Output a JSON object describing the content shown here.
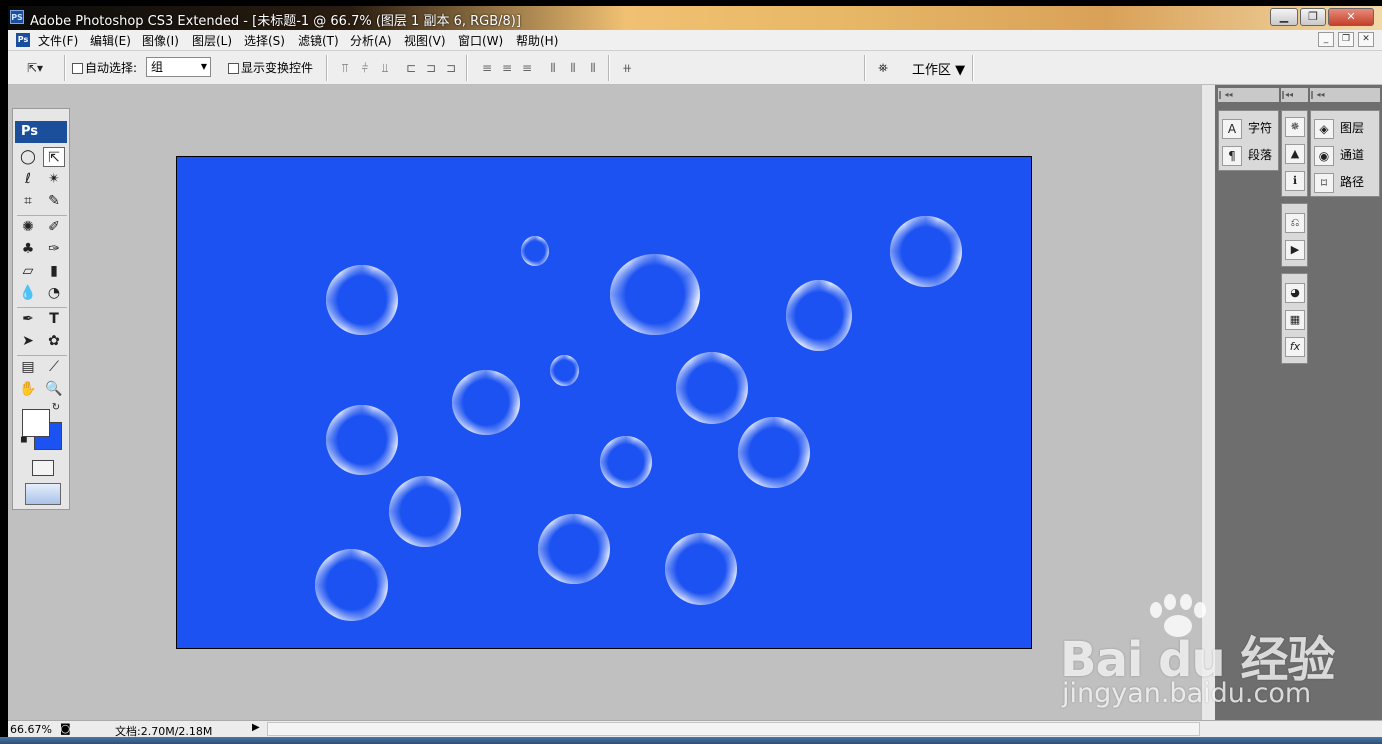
{
  "window": {
    "app_icon": "PS",
    "title": "Adobe Photoshop CS3 Extended - [未标题-1 @ 66.7% (图层 1 副本 6, RGB/8)]",
    "controls": [
      "minimize-icon",
      "restore-icon",
      "close-icon"
    ]
  },
  "menubar": {
    "items": [
      "文件(F)",
      "编辑(E)",
      "图像(I)",
      "图层(L)",
      "选择(S)",
      "滤镜(T)",
      "分析(A)",
      "视图(V)",
      "窗口(W)",
      "帮助(H)"
    ]
  },
  "options": {
    "auto_select_label": "自动选择:",
    "auto_select_value": "组",
    "show_transform_label": "显示变换控件",
    "workspace_label": "工作区"
  },
  "toolbox": {
    "logo": "Ps",
    "foreground_color": "#ffffff",
    "background_color": "#1c52f1"
  },
  "canvas": {
    "background_color": "#1c52f1",
    "bubble_color": "#ffffff"
  },
  "panels": {
    "col1": [
      "字符",
      "段落"
    ],
    "col3": [
      "图层",
      "通道",
      "路径"
    ]
  },
  "statusbar": {
    "zoom": "66.67%",
    "doc_info": "文档:2.70M/2.18M"
  },
  "watermark": {
    "logo_text": "Bai du 经验",
    "url": "jingyan.baidu.com"
  }
}
